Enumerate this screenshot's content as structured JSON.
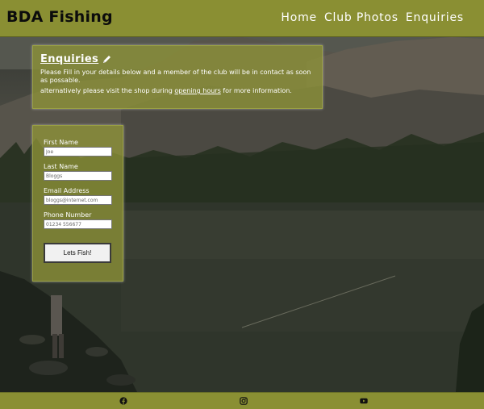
{
  "header": {
    "logo": "BDA Fishing",
    "nav": [
      "Home",
      "Club Photos",
      "Enquiries"
    ]
  },
  "info": {
    "title": "Enquiries",
    "line1": "Please Fill in your details below and a member of the club will be in contact as soon as possable.",
    "line2_prefix": "alternatively please visit the shop during ",
    "line2_link": "opening hours",
    "line2_suffix": " for more information.",
    "icon": "pencil-icon"
  },
  "form": {
    "fields": [
      {
        "label": "First Name",
        "placeholder": "Joe"
      },
      {
        "label": "Last Name",
        "placeholder": "Bloggs"
      },
      {
        "label": "Email Address",
        "placeholder": "bloggs@internet.com"
      },
      {
        "label": "Phone Number",
        "placeholder": "01234 556677"
      }
    ],
    "submit": "Lets Fish!"
  },
  "footer": {
    "icons": [
      "facebook-icon",
      "instagram-icon",
      "youtube-icon"
    ]
  },
  "colors": {
    "brand": "#8a8f33",
    "panel": "#8e9338",
    "text_light": "#ffffff",
    "logo_text": "#0c0c0c"
  }
}
